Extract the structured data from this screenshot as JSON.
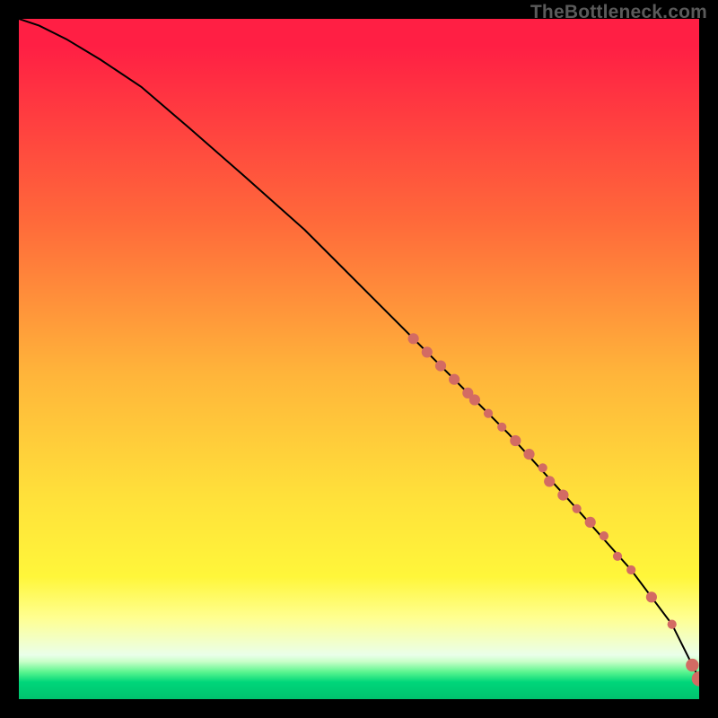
{
  "attribution": "TheBottleneck.com",
  "colors": {
    "background": "#000000",
    "curve": "#000000",
    "marker": "#d36b63",
    "gradient_top": "#ff1f44",
    "gradient_mid": "#ffe03a",
    "gradient_bottom": "#00c26e"
  },
  "chart_data": {
    "type": "line",
    "title": "",
    "xlabel": "",
    "ylabel": "",
    "xlim": [
      0,
      100
    ],
    "ylim": [
      0,
      100
    ],
    "curve": {
      "x": [
        0,
        3,
        7,
        12,
        18,
        25,
        33,
        42,
        52,
        62,
        72,
        82,
        90,
        96,
        99,
        100
      ],
      "y": [
        100,
        99,
        97,
        94,
        90,
        84,
        77,
        69,
        59,
        49,
        39,
        28,
        19,
        11,
        5,
        3
      ]
    },
    "markers": {
      "name": "points-on-curve",
      "x": [
        58,
        60,
        62,
        64,
        66,
        67,
        69,
        71,
        73,
        75,
        77,
        78,
        80,
        82,
        84,
        86,
        88,
        90,
        93,
        96,
        99,
        100
      ],
      "y": [
        53,
        51,
        49,
        47,
        45,
        44,
        42,
        40,
        38,
        36,
        34,
        32,
        30,
        28,
        26,
        24,
        21,
        19,
        15,
        11,
        5,
        3
      ],
      "r": [
        3.8,
        3.8,
        3.8,
        3.8,
        3.8,
        3.8,
        3.2,
        3.2,
        3.8,
        3.8,
        3.2,
        3.8,
        3.8,
        3.2,
        3.8,
        3.2,
        3.2,
        3.2,
        3.8,
        3.2,
        4.5,
        5.2
      ]
    }
  }
}
